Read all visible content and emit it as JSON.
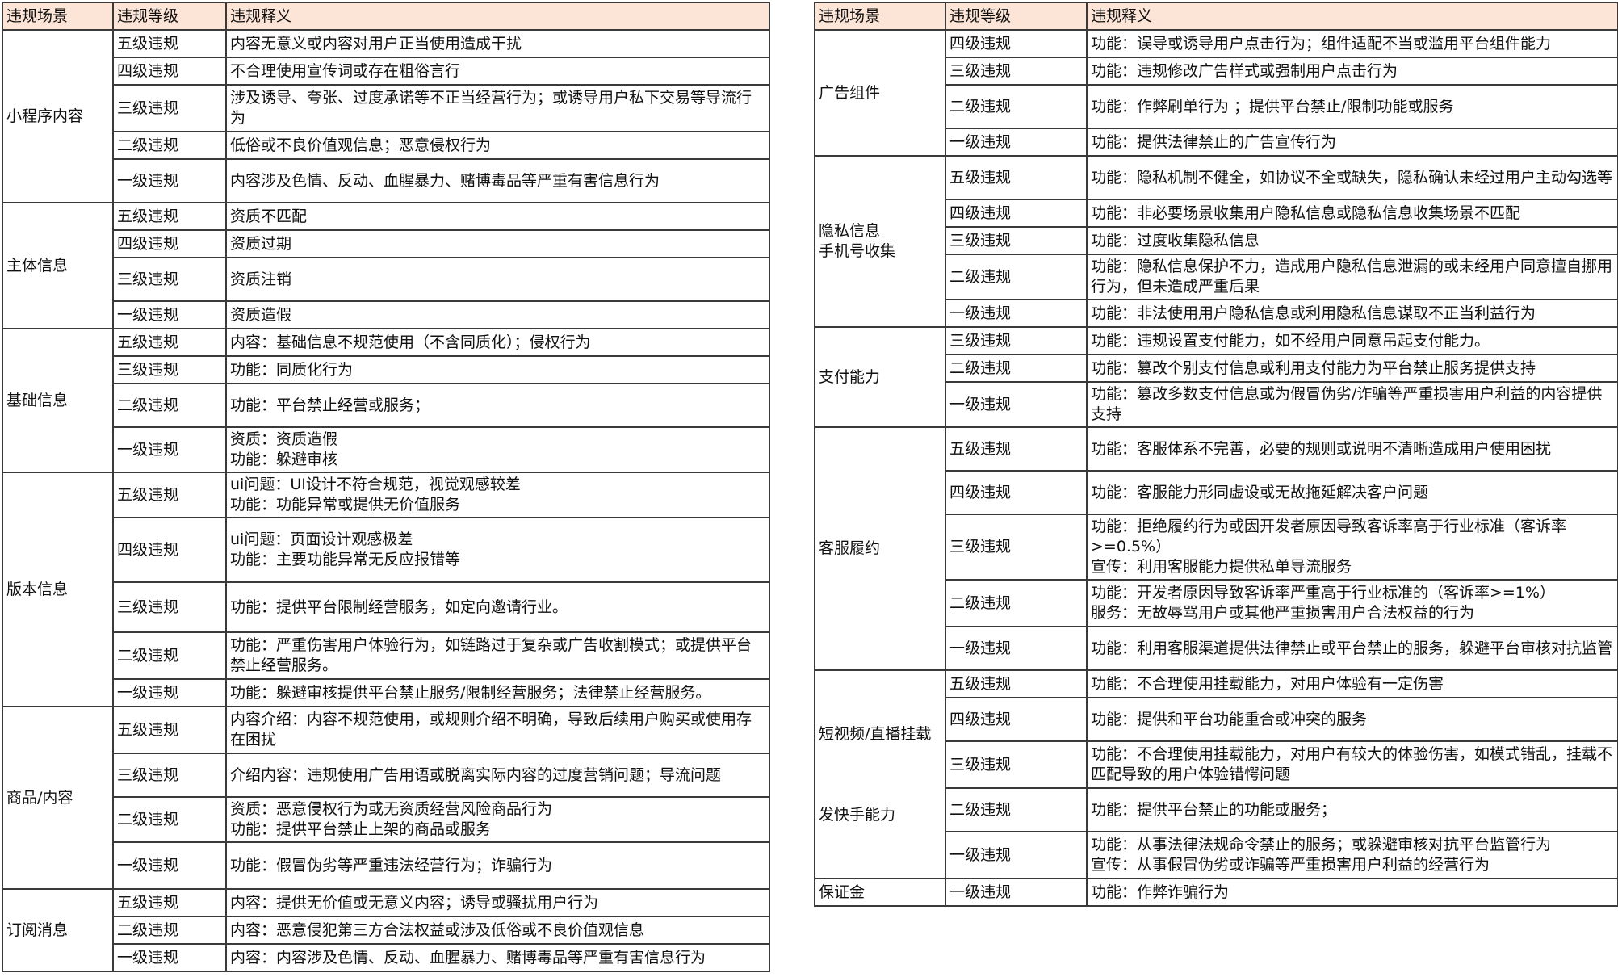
{
  "left": {
    "headers": [
      "违规场景",
      "违规等级",
      "违规释义"
    ],
    "groups": [
      {
        "scene": "小程序内容",
        "rows": [
          [
            "五级违规",
            "内容无意义或内容对用户正当使用造成干扰"
          ],
          [
            "四级违规",
            "不合理使用宣传词或存在粗俗言行"
          ],
          [
            "三级违规",
            "涉及诱导、夸张、过度承诺等不正当经营行为；或诱导用户私下交易等导流行为"
          ],
          [
            "二级违规",
            "低俗或不良价值观信息；恶意侵权行为"
          ],
          [
            "一级违规",
            "内容涉及色情、反动、血腥暴力、赌博毒品等严重有害信息行为"
          ]
        ]
      },
      {
        "scene": "主体信息",
        "rows": [
          [
            "五级违规",
            "资质不匹配"
          ],
          [
            "四级违规",
            "资质过期"
          ],
          [
            "三级违规",
            "资质注销"
          ],
          [
            "一级违规",
            "资质造假"
          ]
        ]
      },
      {
        "scene": "基础信息",
        "rows": [
          [
            "五级违规",
            "内容：基础信息不规范使用（不含同质化）；侵权行为"
          ],
          [
            "三级违规",
            "功能：同质化行为"
          ],
          [
            "二级违规",
            "功能：平台禁止经营或服务；"
          ],
          [
            "一级违规",
            "资质：资质造假\n功能：躲避审核"
          ]
        ]
      },
      {
        "scene": "版本信息",
        "rows": [
          [
            "五级违规",
            "ui问题：UI设计不符合规范，视觉观感较差\n功能：功能异常或提供无价值服务"
          ],
          [
            "四级违规",
            "ui问题：页面设计观感极差\n功能：主要功能异常无反应报错等"
          ],
          [
            "三级违规",
            "功能：提供平台限制经营服务，如定向邀请行业。"
          ],
          [
            "二级违规",
            "功能：严重伤害用户体验行为，如链路过于复杂或广告收割模式；或提供平台禁止经营服务。"
          ],
          [
            "一级违规",
            "功能：躲避审核提供平台禁止服务/限制经营服务；法律禁止经营服务。"
          ]
        ]
      },
      {
        "scene": "商品/内容",
        "rows": [
          [
            "五级违规",
            "内容介绍：内容不规范使用，或规则介绍不明确，导致后续用户购买或使用存在困扰"
          ],
          [
            "三级违规",
            "介绍内容：违规使用广告用语或脱离实际内容的过度营销问题；导流问题"
          ],
          [
            "二级违规",
            "资质：恶意侵权行为或无资质经营风险商品行为\n功能：提供平台禁止上架的商品或服务"
          ],
          [
            "一级违规",
            "功能：假冒伪劣等严重违法经营行为；诈骗行为"
          ]
        ]
      },
      {
        "scene": "订阅消息",
        "rows": [
          [
            "五级违规",
            "内容：提供无价值或无意义内容；诱导或骚扰用户行为"
          ],
          [
            "二级违规",
            "内容：恶意侵犯第三方合法权益或涉及低俗或不良价值观信息"
          ],
          [
            "一级违规",
            "内容：内容涉及色情、反动、血腥暴力、赌博毒品等严重有害信息行为"
          ]
        ]
      }
    ]
  },
  "right": {
    "headers": [
      "违规场景",
      "违规等级",
      "违规释义"
    ],
    "groups": [
      {
        "scene": "广告组件",
        "rows": [
          [
            "四级违规",
            "功能：误导或诱导用户点击行为；组件适配不当或滥用平台组件能力"
          ],
          [
            "三级违规",
            "功能：违规修改广告样式或强制用户点击行为"
          ],
          [
            "二级违规",
            "功能：作弊刷单行为 ；提供平台禁止/限制功能或服务"
          ],
          [
            "一级违规",
            "功能：提供法律禁止的广告宣传行为"
          ]
        ]
      },
      {
        "scene": "隐私信息\n手机号收集",
        "rows": [
          [
            "五级违规",
            "功能：隐私机制不健全，如协议不全或缺失，隐私确认未经过用户主动勾选等"
          ],
          [
            "四级违规",
            "功能：非必要场景收集用户隐私信息或隐私信息收集场景不匹配"
          ],
          [
            "三级违规",
            "功能：过度收集隐私信息"
          ],
          [
            "二级违规",
            "功能：隐私信息保护不力，造成用户隐私信息泄漏的或未经用户同意擅自挪用行为，但未造成严重后果"
          ],
          [
            "一级违规",
            "功能：非法使用用户隐私信息或利用隐私信息谋取不正当利益行为"
          ]
        ]
      },
      {
        "scene": "支付能力",
        "rows": [
          [
            "三级违规",
            "功能：违规设置支付能力，如不经用户同意吊起支付能力。"
          ],
          [
            "二级违规",
            "功能：篡改个别支付信息或利用支付能力为平台禁止服务提供支持"
          ],
          [
            "一级违规",
            "功能：篡改多数支付信息或为假冒伪劣/诈骗等严重损害用户利益的内容提供支持"
          ]
        ]
      },
      {
        "scene": "客服履约",
        "rows": [
          [
            "五级违规",
            "功能：客服体系不完善，必要的规则或说明不清晰造成用户使用困扰"
          ],
          [
            "四级违规",
            "功能：客服能力形同虚设或无故拖延解决客户问题"
          ],
          [
            "三级违规",
            "功能：拒绝履约行为或因开发者原因导致客诉率高于行业标准（客诉率>=0.5%）\n宣传：利用客服能力提供私单导流服务"
          ],
          [
            "二级违规",
            "功能：开发者原因导致客诉率严重高于行业标准的（客诉率>=1%）\n服务：无故辱骂用户或其他严重损害用户合法权益的行为"
          ],
          [
            "一级违规",
            "功能：利用客服渠道提供法律禁止或平台禁止的服务，躲避平台审核对抗监管"
          ]
        ]
      },
      {
        "scene": "短视频/直播挂载\n\n\n\n发快手能力",
        "rows": [
          [
            "五级违规",
            "功能：不合理使用挂载能力，对用户体验有一定伤害"
          ],
          [
            "四级违规",
            "功能：提供和平台功能重合或冲突的服务"
          ],
          [
            "三级违规",
            "功能：不合理使用挂载能力，对用户有较大的体验伤害，如模式错乱，挂载不匹配导致的用户体验错愕问题"
          ],
          [
            "二级违规",
            "功能：提供平台禁止的功能或服务；"
          ],
          [
            "一级违规",
            "功能：从事法律法规命令禁止的服务；或躲避审核对抗平台监管行为\n宣传：从事假冒伪劣或诈骗等严重损害用户利益的经营行为"
          ]
        ]
      },
      {
        "scene": "保证金",
        "rows": [
          [
            "一级违规",
            "功能：作弊诈骗行为"
          ]
        ]
      }
    ]
  }
}
